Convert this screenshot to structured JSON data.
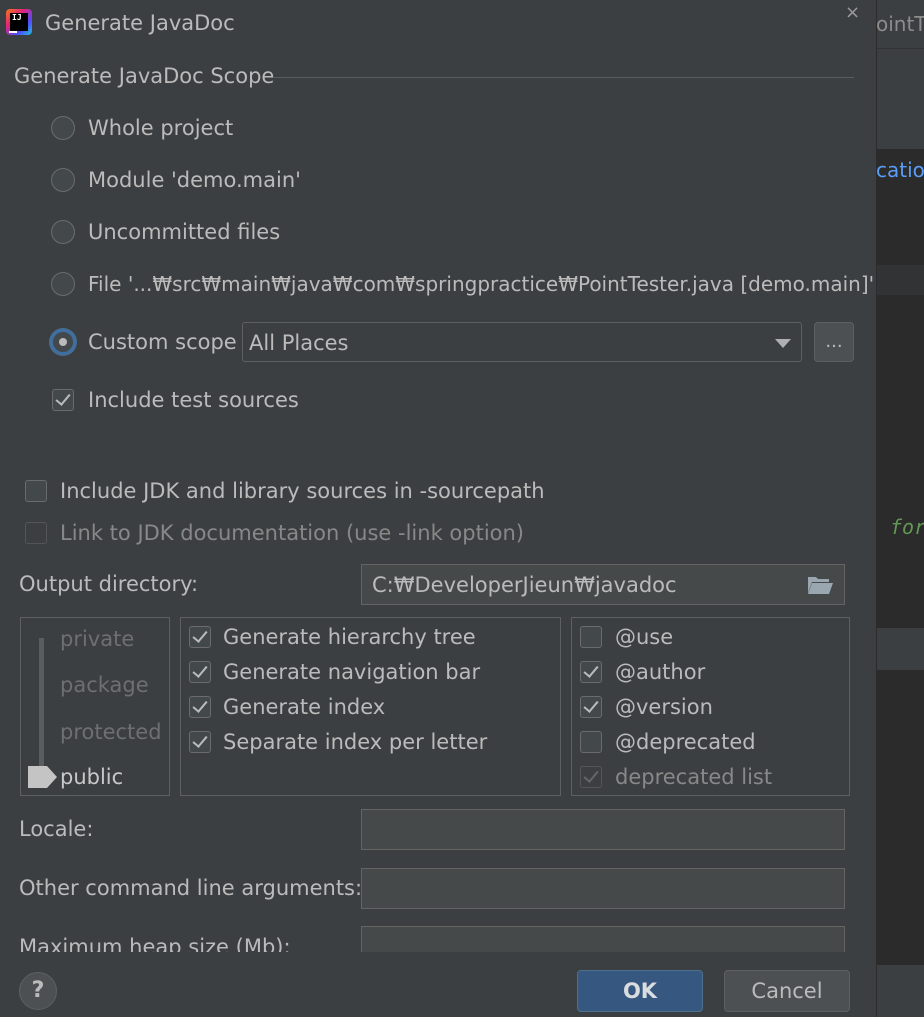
{
  "window": {
    "title": "Generate JavaDoc",
    "close_symbol": "×",
    "app_icon_text": "IJ"
  },
  "background": {
    "tab_text": "ointTe",
    "link_text": "catior",
    "code_text": "for"
  },
  "scope": {
    "heading": "Generate JavaDoc Scope",
    "options": [
      "Whole project",
      "Module 'demo.main'",
      "Uncommitted files",
      "File '...₩src₩main₩java₩com₩springpractice₩PointTester.java [demo.main]'",
      "Custom scope"
    ],
    "selected": "Custom scope",
    "custom_scope_value": "All Places",
    "browse_label": "...",
    "include_test_sources": "Include test sources"
  },
  "options": {
    "include_jdk": "Include JDK and library sources in -sourcepath",
    "link_jdk": "Link to JDK documentation (use -link option)",
    "output_label": "Output directory:",
    "output_value": "C:₩DeveloperJieun₩javadoc"
  },
  "visibility": {
    "levels": [
      "private",
      "package",
      "protected",
      "public"
    ],
    "selected": "public"
  },
  "generate": {
    "items": [
      "Generate hierarchy tree",
      "Generate navigation bar",
      "Generate index",
      "Separate index per letter"
    ]
  },
  "tags": {
    "items": [
      "@use",
      "@author",
      "@version",
      "@deprecated",
      "deprecated list"
    ]
  },
  "fields": {
    "locale_label": "Locale:",
    "locale_value": "",
    "other_args_label": "Other command line arguments:",
    "other_args_value": "",
    "heap_label": "Maximum heap size (Mb):"
  },
  "footer": {
    "help_label": "?",
    "ok_label": "OK",
    "cancel_label": "Cancel"
  },
  "colors": {
    "background": "#3c3f41",
    "accent": "#365880",
    "text": "#bbbbbb"
  }
}
